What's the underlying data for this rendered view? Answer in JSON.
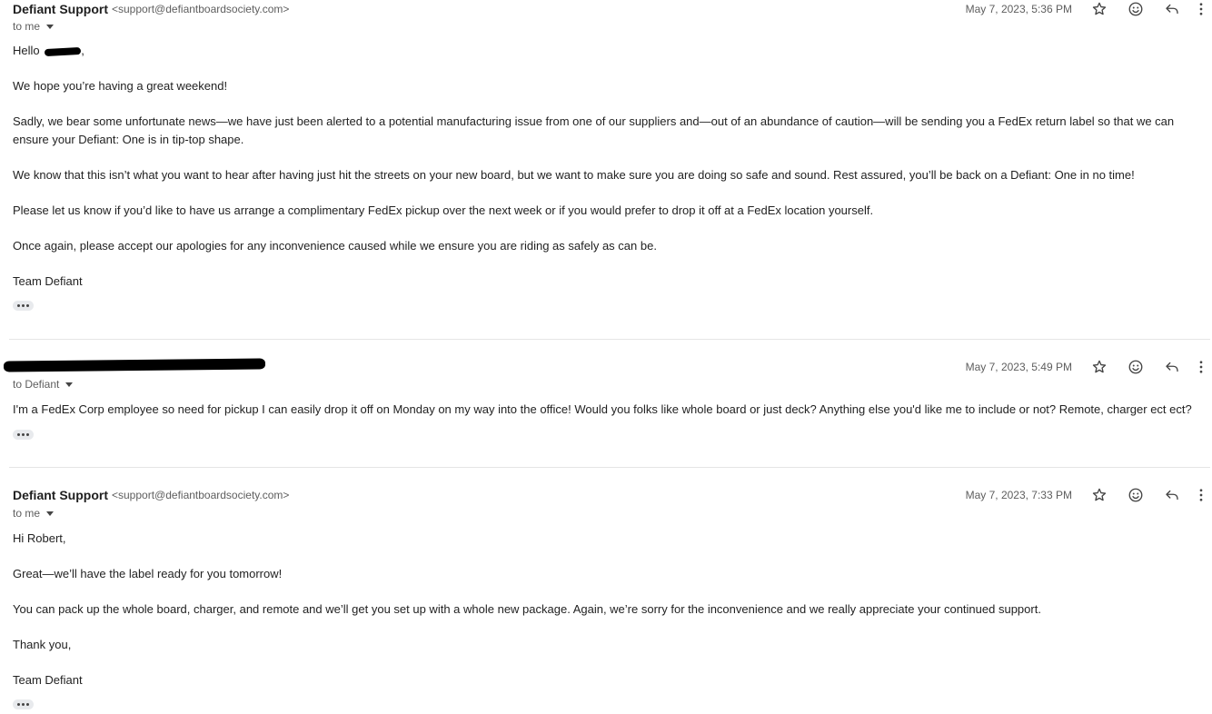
{
  "messages": [
    {
      "sender_name": "Defiant Support",
      "sender_email": "<support@defiantboardsociety.com>",
      "to": "to me",
      "date": "May 7, 2023, 5:36 PM",
      "greeting_prefix": "Hello",
      "greeting_suffix": ",",
      "paragraphs": [
        "We hope you’re having a great weekend!",
        "Sadly, we bear some unfortunate news—we have just been alerted to a potential manufacturing issue from one of our suppliers and—out of an abundance of caution—will be sending you a FedEx return label so that we can ensure your Defiant: One is in tip-top shape.",
        "We know that this isn’t what you want to hear after having just hit the streets on your new board, but we want to make sure you are doing so safe and sound. Rest assured, you’ll be back on a Defiant: One in no time!",
        "Please let us know if you’d like to have us arrange a complimentary FedEx pickup over the next week or if you would prefer to drop it off at a FedEx location yourself.",
        "Once again, please accept our apologies for any inconvenience caused while we ensure you are riding as safely as can be.",
        "Team Defiant"
      ]
    },
    {
      "to": "to Defiant",
      "date": "May 7, 2023, 5:49 PM",
      "paragraphs": [
        "I'm a FedEx Corp employee so need for pickup I can easily drop it off on Monday on my way into the office! Would you folks like whole board or just deck? Anything else you'd like me to include or not? Remote, charger ect ect?"
      ]
    },
    {
      "sender_name": "Defiant Support",
      "sender_email": "<support@defiantboardsociety.com>",
      "to": "to me",
      "date": "May 7, 2023, 7:33 PM",
      "paragraphs": [
        "Hi Robert,",
        "Great—we’ll have the label ready for you tomorrow!",
        "You can pack up the whole board, charger, and remote and we’ll get you set up with a whole new package. Again, we’re sorry for the inconvenience and we really appreciate your continued support.",
        "Thank you,",
        "Team Defiant"
      ]
    }
  ],
  "icons": {
    "star": "star-icon",
    "emoji": "emoji-icon",
    "reply": "reply-icon",
    "more": "more-vert-icon",
    "show_trimmed": "ellipsis-icon",
    "caret": "chevron-down-icon"
  },
  "colors": {
    "text": "#222222",
    "secondary": "#5e5e5e",
    "divider": "#e5e5e5",
    "ellipsis_bg": "#e8eaed"
  }
}
